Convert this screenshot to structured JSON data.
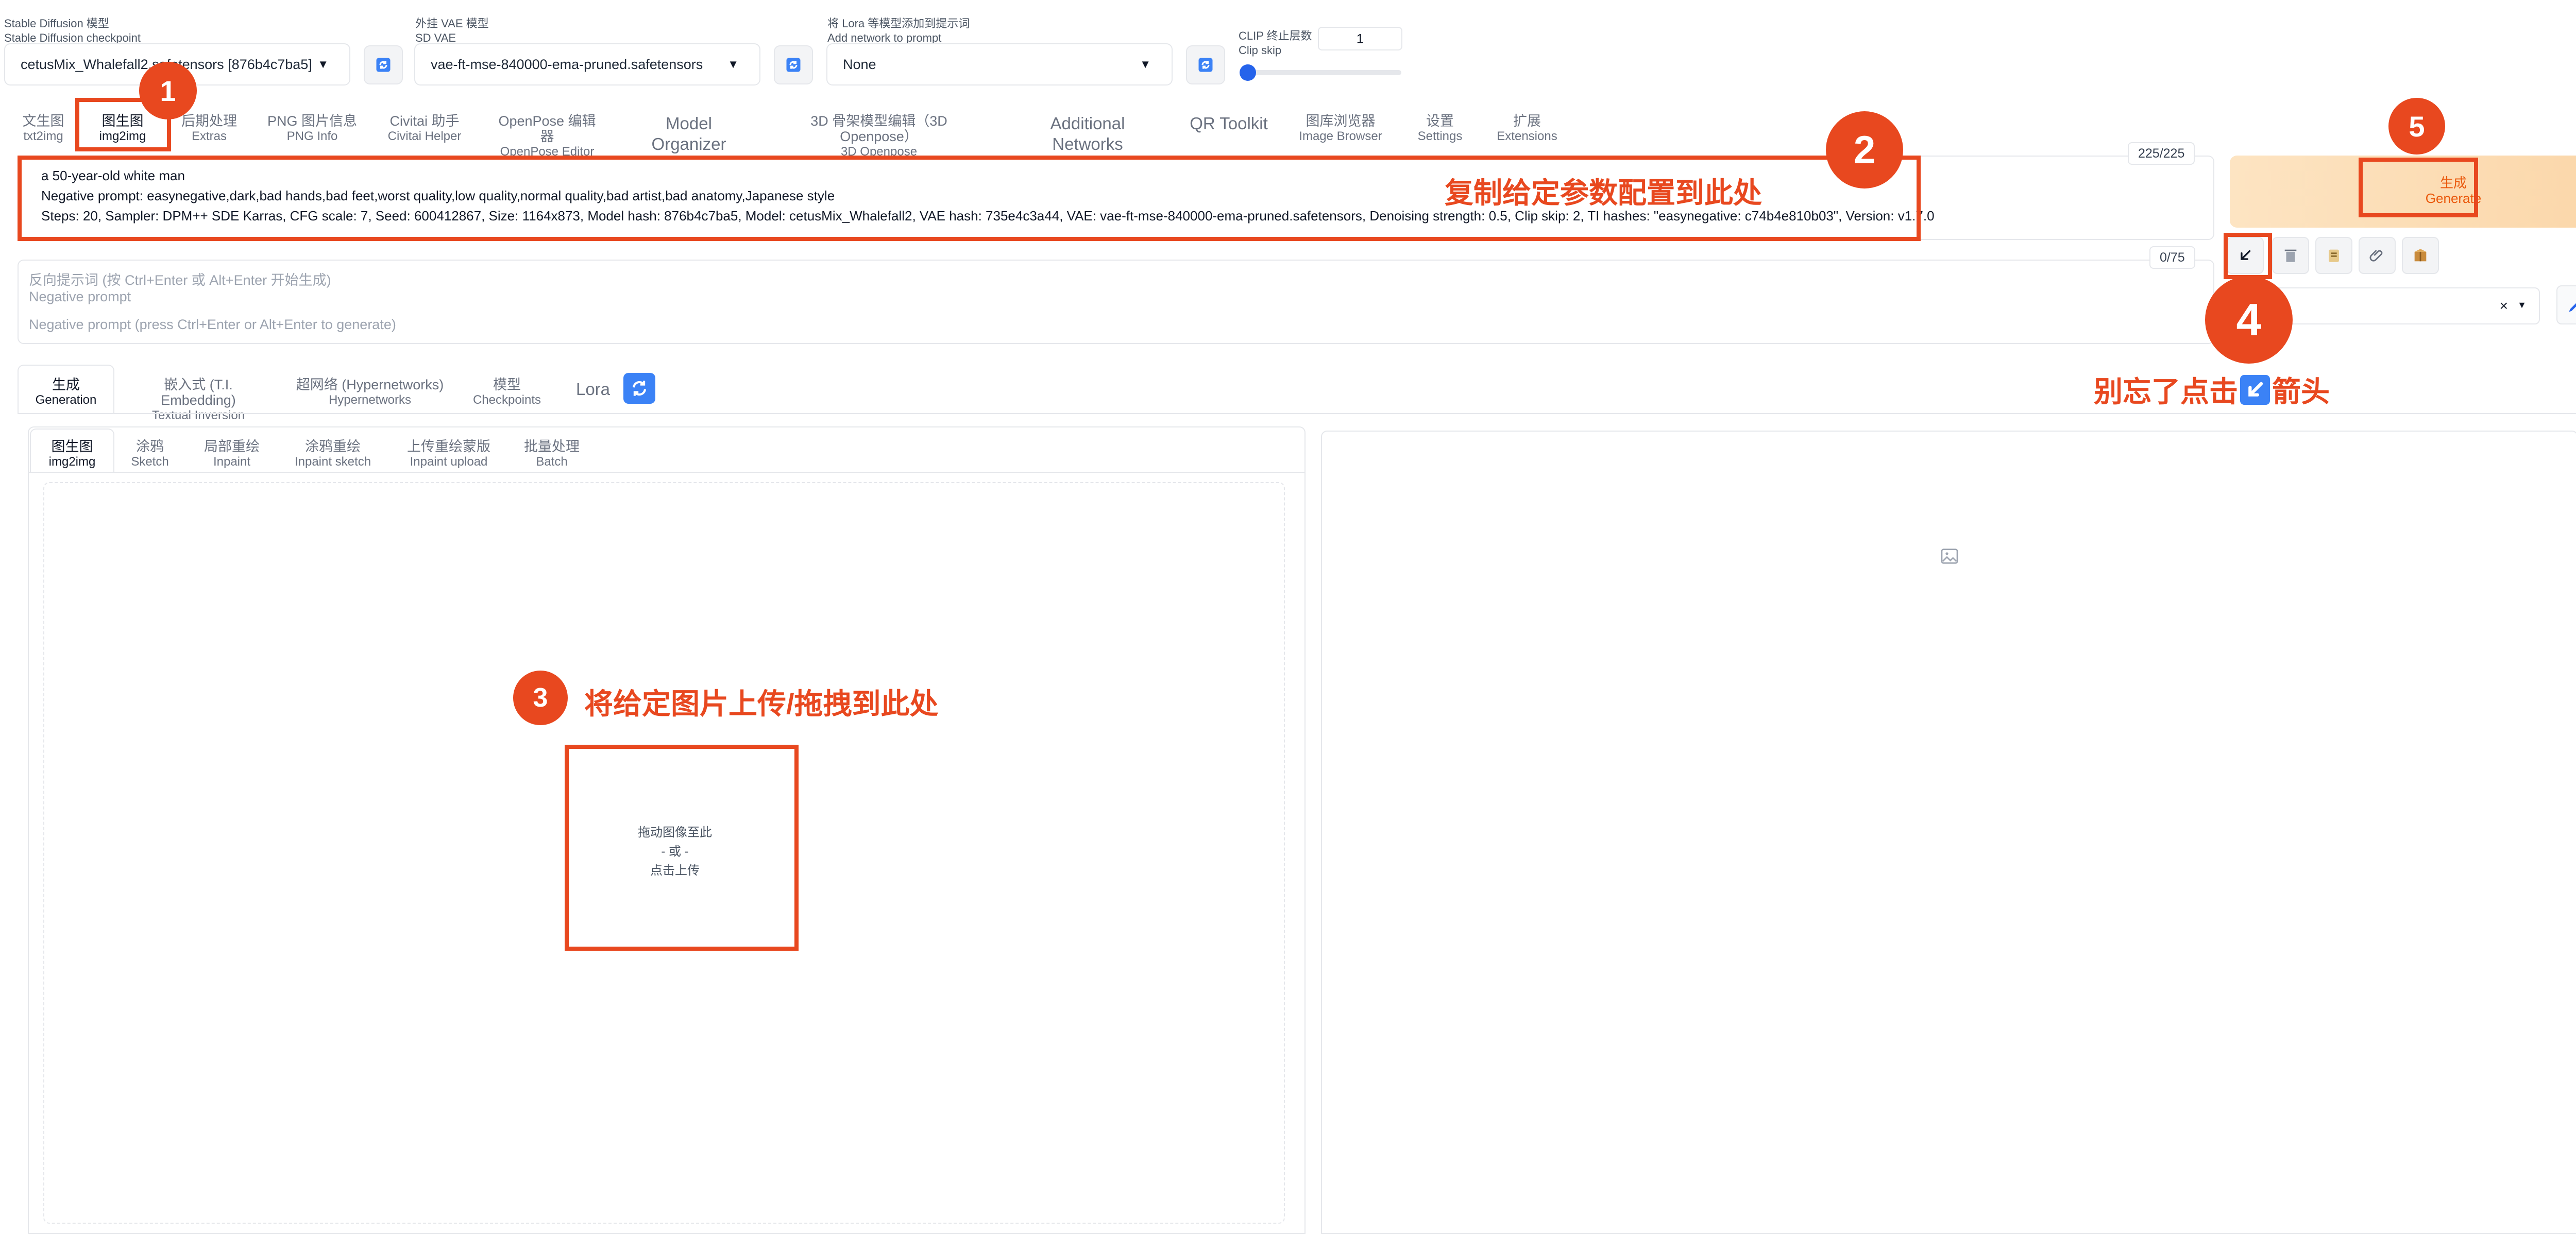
{
  "models": {
    "sd": {
      "label_cn": "Stable Diffusion 模型",
      "label_en": "Stable Diffusion checkpoint",
      "value": "cetusMix_Whalefall2.safetensors [876b4c7ba5]"
    },
    "vae": {
      "label_cn": "外挂 VAE 模型",
      "label_en": "SD VAE",
      "value": "vae-ft-mse-840000-ema-pruned.safetensors"
    },
    "lora": {
      "label_cn": "将 Lora 等模型添加到提示词",
      "label_en": "Add network to prompt",
      "value": "None"
    },
    "clip": {
      "label_cn": "CLIP 终止层数",
      "label_en": "Clip skip",
      "value": "1",
      "slider_fraction": 0.0
    }
  },
  "main_tabs": [
    {
      "cn": "文生图",
      "en": "txt2img"
    },
    {
      "cn": "图生图",
      "en": "img2img"
    },
    {
      "cn": "后期处理",
      "en": "Extras"
    },
    {
      "cn": "PNG 图片信息",
      "en": "PNG Info"
    },
    {
      "cn": "Civitai 助手",
      "en": "Civitai Helper"
    },
    {
      "cn": "OpenPose 编辑器",
      "en": "OpenPose Editor"
    },
    {
      "cn": "Model Organizer",
      "en": ""
    },
    {
      "cn": "3D 骨架模型编辑（3D Openpose）",
      "en": "3D Openpose"
    },
    {
      "cn": "Additional Networks",
      "en": ""
    },
    {
      "cn": "QR Toolkit",
      "en": ""
    },
    {
      "cn": "图库浏览器",
      "en": "Image Browser"
    },
    {
      "cn": "设置",
      "en": "Settings"
    },
    {
      "cn": "扩展",
      "en": "Extensions"
    }
  ],
  "prompt": {
    "line1": "a 50-year-old white man",
    "line2": "Negative prompt: easynegative,dark,bad hands,bad feet,worst quality,low quality,normal quality,bad artist,bad anatomy,Japanese style",
    "line3": "Steps: 20, Sampler: DPM++ SDE Karras, CFG scale: 7, Seed: 600412867, Size: 1164x873, Model hash: 876b4c7ba5, Model: cetusMix_Whalefall2, VAE hash: 735e4c3a44, VAE: vae-ft-mse-840000-ema-pruned.safetensors, Denoising strength: 0.5, Clip skip: 2, TI hashes: \"easynegative: c74b4e810b03\", Version: v1.7.0",
    "counter": "225/225"
  },
  "negative": {
    "placeholder_cn": "反向提示词 (按 Ctrl+Enter 或 Alt+Enter 开始生成)",
    "placeholder_en": "Negative prompt",
    "placeholder_en2": "Negative prompt (press Ctrl+Enter or Alt+Enter to generate)",
    "counter": "0/75"
  },
  "generate": {
    "cn": "生成",
    "en": "Generate"
  },
  "sub_tabs": [
    {
      "cn": "生成",
      "en": "Generation"
    },
    {
      "cn": "嵌入式 (T.I. Embedding)",
      "en": "Textual Inversion"
    },
    {
      "cn": "超网络 (Hypernetworks)",
      "en": "Hypernetworks"
    },
    {
      "cn": "模型",
      "en": "Checkpoints"
    },
    {
      "cn": "Lora",
      "en": ""
    }
  ],
  "img_tabs": [
    {
      "cn": "图生图",
      "en": "img2img"
    },
    {
      "cn": "涂鸦",
      "en": "Sketch"
    },
    {
      "cn": "局部重绘",
      "en": "Inpaint"
    },
    {
      "cn": "涂鸦重绘",
      "en": "Inpaint sketch"
    },
    {
      "cn": "上传重绘蒙版",
      "en": "Inpaint upload"
    },
    {
      "cn": "批量处理",
      "en": "Batch"
    }
  ],
  "upload": {
    "line1": "拖动图像至此",
    "line2": "- 或 -",
    "line3": "点击上传"
  },
  "annotations": {
    "n1": "1",
    "n2": "2",
    "n3": "3",
    "n4": "4",
    "n5": "5",
    "t2": "复制给定参数配置到此处",
    "t3": "将给定图片上传/拖拽到此处",
    "t4_pre": "别忘了点击",
    "t4_post": "箭头"
  },
  "colors": {
    "annotation_red": "#e8481f",
    "generate_bg": "#fbd7aa",
    "generate_text": "#ea580c",
    "slider_blue": "#2563eb"
  }
}
